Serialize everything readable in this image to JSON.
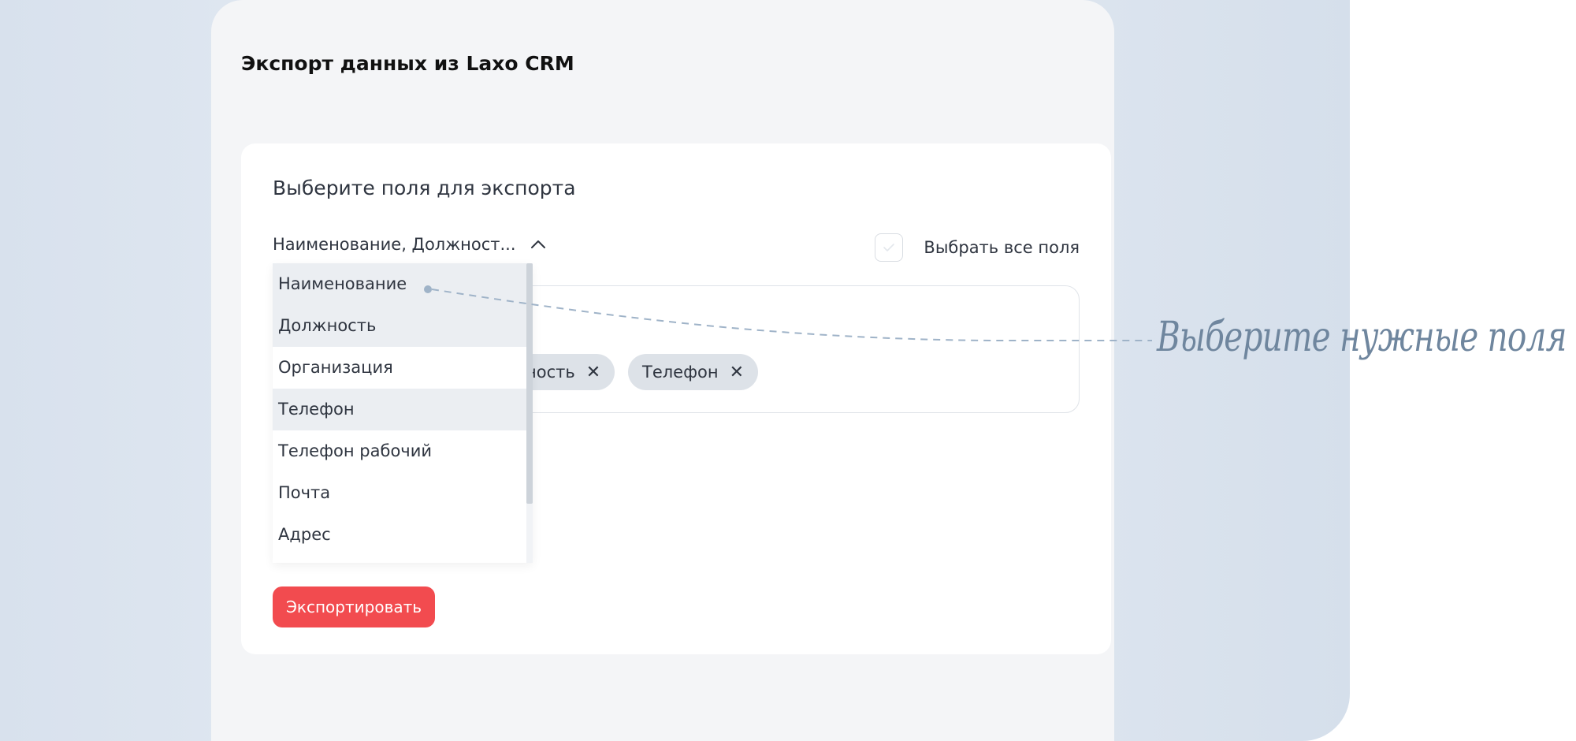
{
  "page_title": "Экспорт данных из Laxo CRM",
  "card": {
    "title": "Выберите поля для экспорта",
    "select_value": "Наименование, Должност...",
    "select_all_label": "Выбрать все поля",
    "select_all_checked": false
  },
  "tags": [
    {
      "label": "ность"
    },
    {
      "label": "Телефон"
    }
  ],
  "dropdown": {
    "items": [
      {
        "label": "Наименование",
        "highlighted": true
      },
      {
        "label": "Должность",
        "highlighted": true
      },
      {
        "label": "Организация",
        "highlighted": false
      },
      {
        "label": "Телефон",
        "highlighted": true
      },
      {
        "label": "Телефон рабочий",
        "highlighted": false
      },
      {
        "label": "Почта",
        "highlighted": false
      },
      {
        "label": "Адрес",
        "highlighted": false
      }
    ]
  },
  "export_button": "Экспортировать",
  "callout": "Выберите нужные поля",
  "colors": {
    "accent": "#f24b4f",
    "callout": "#6f869e",
    "tag_bg": "#dde2e8",
    "highlight": "#ebeef2"
  },
  "icons": {
    "select_toggle": "chevron-up-icon",
    "tag_remove": "close-icon",
    "checkbox": "checkmark-icon"
  }
}
